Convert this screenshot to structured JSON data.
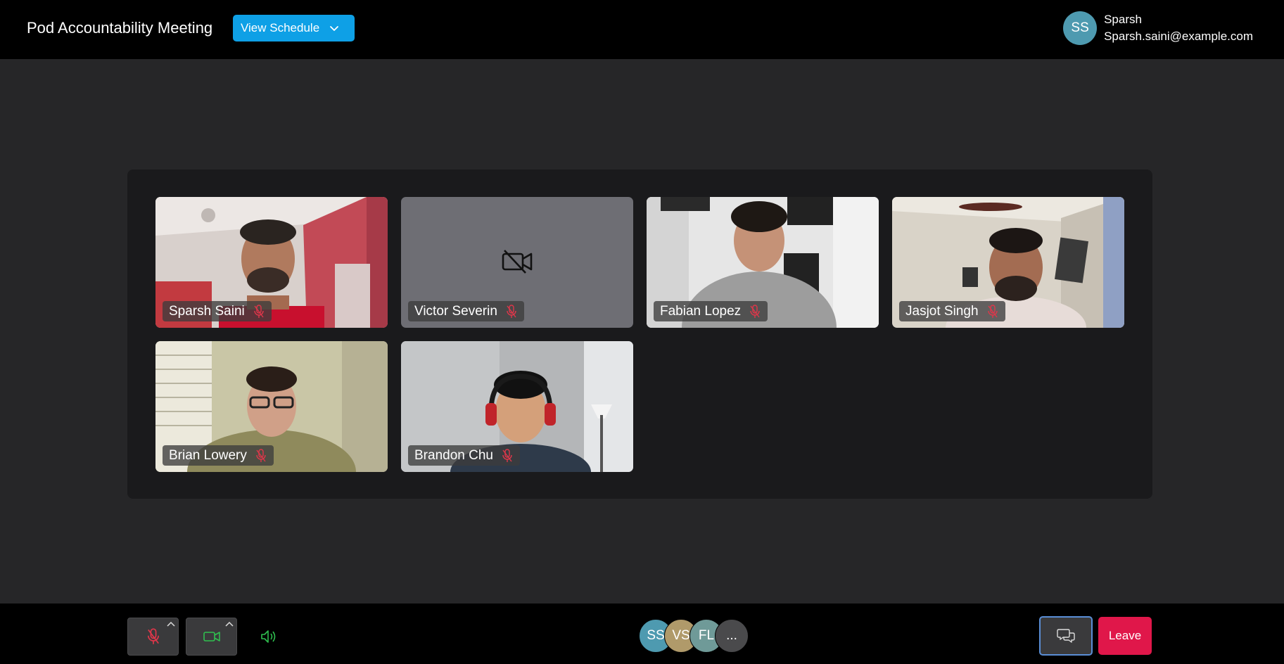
{
  "header": {
    "meeting_title": "Pod Accountability Meeting",
    "schedule_button": "View Schedule",
    "user": {
      "initials": "SS",
      "name": "Sparsh",
      "email": "Sparsh.saini@example.com",
      "avatar_color": "#4e9ab0"
    }
  },
  "tiles": [
    {
      "name": "Sparsh Saini",
      "muted": true,
      "video": true
    },
    {
      "name": "Victor Severin",
      "muted": true,
      "video": false,
      "icon": "video-off-icon"
    },
    {
      "name": "Fabian Lopez",
      "muted": true,
      "video": true
    },
    {
      "name": "Jasjot Singh",
      "muted": true,
      "video": true
    },
    {
      "name": "Brian Lowery",
      "muted": true,
      "video": true
    },
    {
      "name": "Brandon Chu",
      "muted": true,
      "video": true
    }
  ],
  "controls": {
    "mic": {
      "state": "off",
      "icon": "mic-off-icon",
      "color": "#e0364a"
    },
    "camera": {
      "state": "on",
      "icon": "camera-icon",
      "color": "#2fbf4f"
    },
    "speaker": {
      "icon": "speaker-icon",
      "color": "#2fbf4f"
    }
  },
  "participants": [
    {
      "initials": "SS",
      "color": "#4e9ab0"
    },
    {
      "initials": "VS",
      "color": "#b09a6a"
    },
    {
      "initials": "FL",
      "color": "#6f9a98"
    },
    {
      "initials": "...",
      "color": "#4a4a4c"
    }
  ],
  "chat": {
    "icon": "chat-icon"
  },
  "leave_button": "Leave",
  "colors": {
    "accent": "#0ea0e6",
    "leave": "#e0174a",
    "background": "#262628",
    "stage": "#1a1a1c"
  }
}
